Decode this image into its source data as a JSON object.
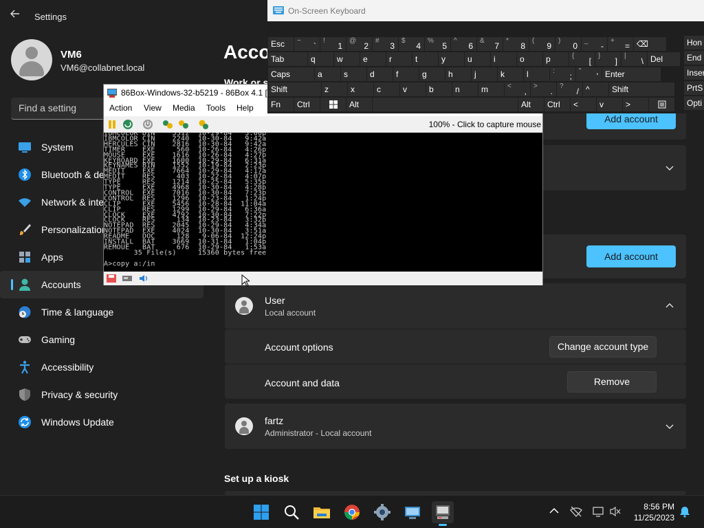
{
  "settings": {
    "app_title": "Settings",
    "profile": {
      "name": "VM6",
      "email": "VM6@collabnet.local"
    },
    "search_placeholder": "Find a setting",
    "nav": [
      {
        "label": "System",
        "icon": "monitor-icon"
      },
      {
        "label": "Bluetooth & devices",
        "icon": "bluetooth-icon"
      },
      {
        "label": "Network & internet",
        "icon": "wifi-icon"
      },
      {
        "label": "Personalization",
        "icon": "paintbrush-icon"
      },
      {
        "label": "Apps",
        "icon": "apps-icon"
      },
      {
        "label": "Accounts",
        "icon": "person-icon",
        "active": true
      },
      {
        "label": "Time & language",
        "icon": "clock-globe-icon"
      },
      {
        "label": "Gaming",
        "icon": "gamepad-icon"
      },
      {
        "label": "Accessibility",
        "icon": "accessibility-icon"
      },
      {
        "label": "Privacy & security",
        "icon": "shield-icon"
      },
      {
        "label": "Windows Update",
        "icon": "update-icon"
      }
    ],
    "page_title": "Acco",
    "section_work": "Work or s",
    "add_account_label": "Add account",
    "user_card": {
      "name": "User",
      "type": "Local account"
    },
    "account_options_label": "Account options",
    "change_type_label": "Change account type",
    "account_data_label": "Account and data",
    "remove_label": "Remove",
    "fartz_card": {
      "name": "fartz",
      "type": "Administrator - Local account"
    },
    "kiosk_heading": "Set up a kiosk"
  },
  "box86": {
    "title": "86Box-Windows-32-b5219 - 86Box 4.1 [I",
    "menu": [
      "Action",
      "View",
      "Media",
      "Tools",
      "Help"
    ],
    "status_text": "100% - Click to capture mouse",
    "dos_lines": [
      "IBMCOLOR DIN    5312  10-29-84   3:00p",
      "IBMCOLOR CIN    2240  10-30-84   9:42a",
      "HERCULES CIN    2816  10-30-84   9:42a",
      "TIMER    EXE     560  10-26-84   4:26p",
      "MOUSE    EXE    1616  10-26-84   4:27p",
      "KEYBOARD EXE    1600  10-29-84   6:31a",
      "KEYNAMES BIN    1552  10-19-84   2:23p",
      "MEDIT    EXE    7664  10-29-84   4:17a",
      "MEDIT    RES     403  10-22-84   4:07p",
      "TYPE     RES    1214  10-25-84   5:35p",
      "TYPE     EXE    4968  10-30-84   4:28p",
      "CONTROL  EXE    7016  10-30-84   7:23p",
      "CONTROL  RES    1296  10-23-84   1:24p",
      "CLIP     EXE    5456  10-28-84  11:04a",
      "CLIP     RES    1299  10-29-84   6:36a",
      "CLOCK    EXE    4792  10-30-84   7:22p",
      "CLOCK    RES     134  10-23-84   3:32p",
      "NOTEPAD  RES    2045  10-29-84   4:34a",
      "NOTEPAD  EXE    4024  10-30-84   3:51a",
      "README   DOC     128   9-06-84  12:24p",
      "INSTALL  BAT    3669  10-31-84   1:04p",
      "REMOUE   BAT     676  10-29-84   1:53a",
      "       35 File(s)     15360 bytes free",
      "",
      "A>copy a:/in"
    ]
  },
  "osk": {
    "title": "On-Screen Keyboard",
    "row1": [
      {
        "main": "Esc"
      },
      {
        "shift": "~",
        "main": "`"
      },
      {
        "shift": "!",
        "main": "1"
      },
      {
        "shift": "@",
        "main": "2"
      },
      {
        "shift": "#",
        "main": "3"
      },
      {
        "shift": "$",
        "main": "4"
      },
      {
        "shift": "%",
        "main": "5"
      },
      {
        "shift": "^",
        "main": "6"
      },
      {
        "shift": "&",
        "main": "7"
      },
      {
        "shift": "*",
        "main": "8"
      },
      {
        "shift": "(",
        "main": "9"
      },
      {
        "shift": ")",
        "main": "0"
      },
      {
        "shift": "_",
        "main": "-"
      },
      {
        "shift": "+",
        "main": "="
      },
      {
        "main": "⌫"
      }
    ],
    "row2": [
      {
        "main": "Tab"
      },
      {
        "main": "q"
      },
      {
        "main": "w"
      },
      {
        "main": "e"
      },
      {
        "main": "r"
      },
      {
        "main": "t"
      },
      {
        "main": "y"
      },
      {
        "main": "u"
      },
      {
        "main": "i"
      },
      {
        "main": "o"
      },
      {
        "main": "p"
      },
      {
        "shift": "{",
        "main": "["
      },
      {
        "shift": "}",
        "main": "]"
      },
      {
        "shift": "|",
        "main": "\\"
      },
      {
        "main": "Del"
      }
    ],
    "row3": [
      {
        "main": "Caps"
      },
      {
        "main": "a"
      },
      {
        "main": "s"
      },
      {
        "main": "d"
      },
      {
        "main": "f"
      },
      {
        "main": "g"
      },
      {
        "main": "h"
      },
      {
        "main": "j"
      },
      {
        "main": "k"
      },
      {
        "main": "l"
      },
      {
        "shift": ":",
        "main": ";"
      },
      {
        "shift": "\"",
        "main": "'"
      },
      {
        "main": "Enter"
      }
    ],
    "row4": [
      {
        "main": "Shift"
      },
      {
        "main": "z"
      },
      {
        "main": "x"
      },
      {
        "main": "c"
      },
      {
        "main": "v"
      },
      {
        "main": "b"
      },
      {
        "main": "n"
      },
      {
        "main": "m"
      },
      {
        "shift": "<",
        "main": ","
      },
      {
        "shift": ">",
        "main": "."
      },
      {
        "shift": "?",
        "main": "/"
      },
      {
        "main": "^"
      },
      {
        "main": "Shift"
      }
    ],
    "row5": [
      {
        "main": "Fn"
      },
      {
        "main": "Ctrl"
      },
      {
        "main": "win"
      },
      {
        "main": "Alt"
      },
      {
        "main": ""
      },
      {
        "main": "Alt"
      },
      {
        "main": "Ctrl"
      },
      {
        "main": "<"
      },
      {
        "main": "v"
      },
      {
        "main": ">"
      },
      {
        "main": "menu"
      }
    ],
    "right_col": [
      "Hon",
      "End",
      "Inser",
      "PrtS",
      "Opti"
    ]
  },
  "taskbar": {
    "apps": [
      "start-icon",
      "search-icon",
      "file-explorer-icon",
      "chrome-icon",
      "settings-gear-icon",
      "remote-desktop-icon",
      "86box-icon"
    ],
    "time": "8:56 PM",
    "date": "11/25/2023"
  },
  "colors": {
    "accent": "#4cc2ff",
    "bg": "#202020",
    "card": "#2b2b2b"
  }
}
